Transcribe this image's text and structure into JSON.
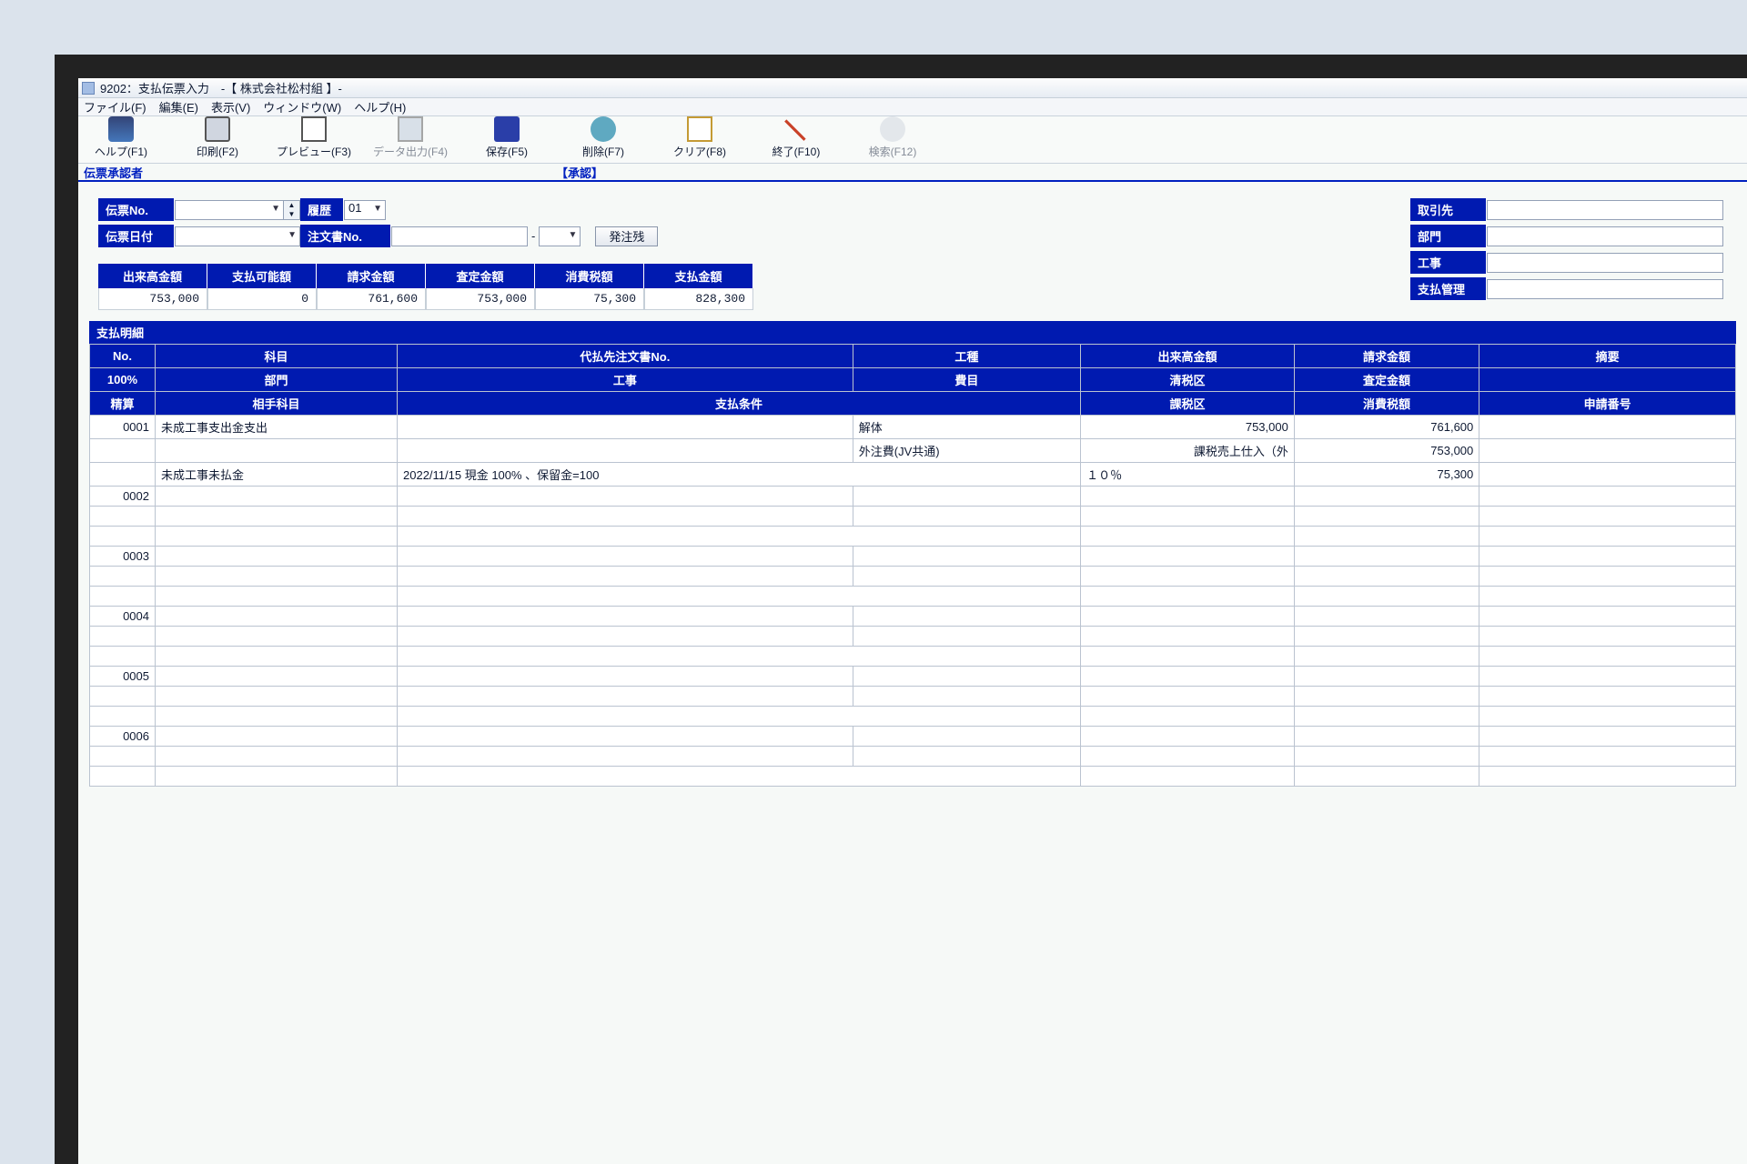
{
  "window": {
    "title": "9202：支払伝票入力　-【 株式会社松村組 】-"
  },
  "menu": {
    "file": "ファイル(F)",
    "edit": "編集(E)",
    "view": "表示(V)",
    "window": "ウィンドウ(W)",
    "help": "ヘルプ(H)"
  },
  "toolbar": {
    "help": "ヘルプ(F1)",
    "print": "印刷(F2)",
    "preview": "プレビュー(F3)",
    "export": "データ出力(F4)",
    "save": "保存(F5)",
    "delete": "削除(F7)",
    "clear": "クリア(F8)",
    "exit": "終了(F10)",
    "search": "検索(F12)"
  },
  "status": {
    "approver_label": "伝票承認者",
    "approved": "【承認】"
  },
  "header": {
    "slip_no_label": "伝票No.",
    "slip_no": "",
    "history_label": "履歴",
    "history_value": "01",
    "slip_date_label": "伝票日付",
    "slip_date": "",
    "order_no_label": "注文書No.",
    "order_no": "",
    "order_no_sub": "",
    "order_remain_btn": "発注残",
    "right": {
      "partner_label": "取引先",
      "partner": "",
      "dept_label": "部門",
      "dept": "",
      "const_label": "工事",
      "const": "",
      "paymgr_label": "支払管理",
      "paymgr": ""
    }
  },
  "totals": {
    "head": [
      "出来高金額",
      "支払可能額",
      "請求金額",
      "査定金額",
      "消費税額",
      "支払金額"
    ],
    "body": [
      "753,000",
      "0",
      "761,600",
      "753,000",
      "75,300",
      "828,300"
    ]
  },
  "grid": {
    "title": "支払明細",
    "head1": [
      "No.",
      "科目",
      "代払先注文書No.",
      "工種",
      "出来高金額",
      "請求金額",
      "摘要"
    ],
    "head2": [
      "100%",
      "部門",
      "工事",
      "費目",
      "清税区",
      "査定金額",
      ""
    ],
    "head3": [
      "精算",
      "相手科目",
      "支払条件",
      "",
      "課税区",
      "消費税額",
      "申請番号"
    ],
    "rows": [
      {
        "no": "0001",
        "r1": [
          "未成工事支出金支出",
          "",
          "解体",
          "753,000",
          "761,600",
          ""
        ],
        "r2": [
          "",
          "",
          "外注費(JV共通)",
          "課税売上仕入（外",
          "753,000",
          ""
        ],
        "r3": [
          "未成工事未払金",
          "2022/11/15 現金 100% 、保留金=100",
          "",
          "１０％",
          "75,300",
          ""
        ]
      },
      {
        "no": "0002",
        "r1": [
          "",
          "",
          "",
          "",
          "",
          ""
        ],
        "r2": [
          "",
          "",
          "",
          "",
          "",
          ""
        ],
        "r3": [
          "",
          "",
          "",
          "",
          "",
          ""
        ]
      },
      {
        "no": "0003",
        "r1": [
          "",
          "",
          "",
          "",
          "",
          ""
        ],
        "r2": [
          "",
          "",
          "",
          "",
          "",
          ""
        ],
        "r3": [
          "",
          "",
          "",
          "",
          "",
          ""
        ]
      },
      {
        "no": "0004",
        "r1": [
          "",
          "",
          "",
          "",
          "",
          ""
        ],
        "r2": [
          "",
          "",
          "",
          "",
          "",
          ""
        ],
        "r3": [
          "",
          "",
          "",
          "",
          "",
          ""
        ]
      },
      {
        "no": "0005",
        "r1": [
          "",
          "",
          "",
          "",
          "",
          ""
        ],
        "r2": [
          "",
          "",
          "",
          "",
          "",
          ""
        ],
        "r3": [
          "",
          "",
          "",
          "",
          "",
          ""
        ]
      },
      {
        "no": "0006",
        "r1": [
          "",
          "",
          "",
          "",
          "",
          ""
        ],
        "r2": [
          "",
          "",
          "",
          "",
          "",
          ""
        ],
        "r3": [
          "",
          "",
          "",
          "",
          "",
          ""
        ]
      }
    ]
  }
}
